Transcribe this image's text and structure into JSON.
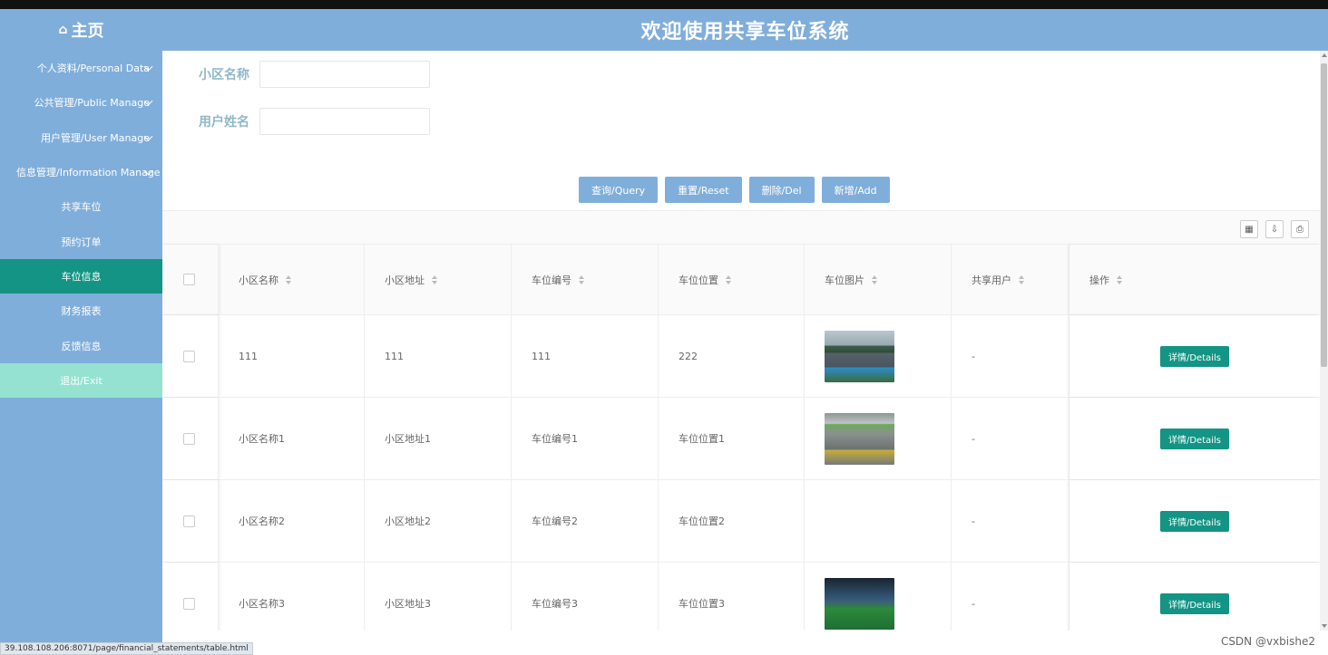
{
  "header": {
    "home_label": "主页",
    "home_icon": "home-icon",
    "title": "欢迎使用共享车位系统",
    "accent": "#80aedb"
  },
  "sidebar": {
    "groups": [
      {
        "label": "个人资料/Personal Data"
      },
      {
        "label": "公共管理/Public Manage"
      },
      {
        "label": "用户管理/User Manage"
      },
      {
        "label": "信息管理/Information Manage"
      }
    ],
    "items": [
      {
        "label": "共享车位"
      },
      {
        "label": "预约订单"
      },
      {
        "label": "车位信息",
        "active": true
      },
      {
        "label": "财务报表"
      },
      {
        "label": "反馈信息"
      },
      {
        "label": "退出/Exit"
      }
    ],
    "active_color": "#139484"
  },
  "search": {
    "community_label": "小区名称",
    "community_value": "",
    "user_label": "用户姓名",
    "user_value": ""
  },
  "actions": {
    "query": "查询/Query",
    "reset": "重置/Reset",
    "delete": "删除/Del",
    "add": "新增/Add"
  },
  "table": {
    "columns": [
      "小区名称",
      "小区地址",
      "车位编号",
      "车位位置",
      "车位图片",
      "共享用户",
      "操作"
    ],
    "rows": [
      {
        "name": "111",
        "address": "111",
        "number": "111",
        "position": "222",
        "image": "parking-lot-photo",
        "user": "-",
        "action": "详情/Details"
      },
      {
        "name": "小区名称1",
        "address": "小区地址1",
        "number": "车位编号1",
        "position": "车位位置1",
        "image": "garage-photo",
        "user": "-",
        "action": "详情/Details"
      },
      {
        "name": "小区名称2",
        "address": "小区地址2",
        "number": "车位编号2",
        "position": "车位位置2",
        "image": "",
        "user": "-",
        "action": "详情/Details"
      },
      {
        "name": "小区名称3",
        "address": "小区地址3",
        "number": "车位编号3",
        "position": "车位位置3",
        "image": "underground-parking-photo",
        "user": "-",
        "action": "详情/Details"
      }
    ]
  },
  "toolbar_icons": [
    "columns-icon",
    "export-icon",
    "print-icon"
  ],
  "statusbar": {
    "url": "39.108.108.206:8071/page/financial_statements/table.html"
  },
  "watermark": "CSDN @vxbishe2"
}
